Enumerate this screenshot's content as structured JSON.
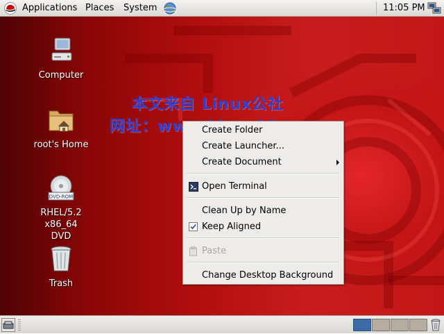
{
  "top_panel": {
    "menus": [
      "Applications",
      "Places",
      "System"
    ],
    "clock": "11:05 PM",
    "icons": [
      "redhat-icon",
      "globe-icon",
      "network-icon"
    ]
  },
  "desktop": {
    "icons": [
      {
        "label": "Computer",
        "icon": "computer-icon"
      },
      {
        "label": "root's Home",
        "icon": "home-folder-icon"
      },
      {
        "label_line1": "RHEL/5.2 x86_64",
        "label_line2": "DVD",
        "badge": "DVD-ROM",
        "icon": "dvd-icon"
      },
      {
        "label": "Trash",
        "icon": "trash-icon"
      }
    ],
    "watermark_line1": "本文来自 Linux公社",
    "watermark_line2": "网址：www.Linuxidc.com"
  },
  "context_menu": {
    "items": [
      {
        "label": "Create Folder"
      },
      {
        "label": "Create Launcher..."
      },
      {
        "label": "Create Document",
        "submenu": true
      },
      {
        "label": "Open Terminal",
        "icon": "terminal-icon"
      },
      {
        "label": "Clean Up by Name"
      },
      {
        "label": "Keep Aligned",
        "checked": true
      },
      {
        "label": "Paste",
        "disabled": true,
        "icon": "paste-icon"
      },
      {
        "label": "Change Desktop Background"
      }
    ]
  },
  "bottom_panel": {
    "workspaces": 4,
    "active_workspace": 1,
    "icons": [
      "show-desktop-icon",
      "trash-icon"
    ]
  },
  "colors": {
    "desktop_dark": "#4e0304",
    "desktop_red": "#c81d1e",
    "menu_bg": "#edeceb",
    "workspace_active": "#3e6aa6",
    "watermark": "#2e3fd0"
  }
}
